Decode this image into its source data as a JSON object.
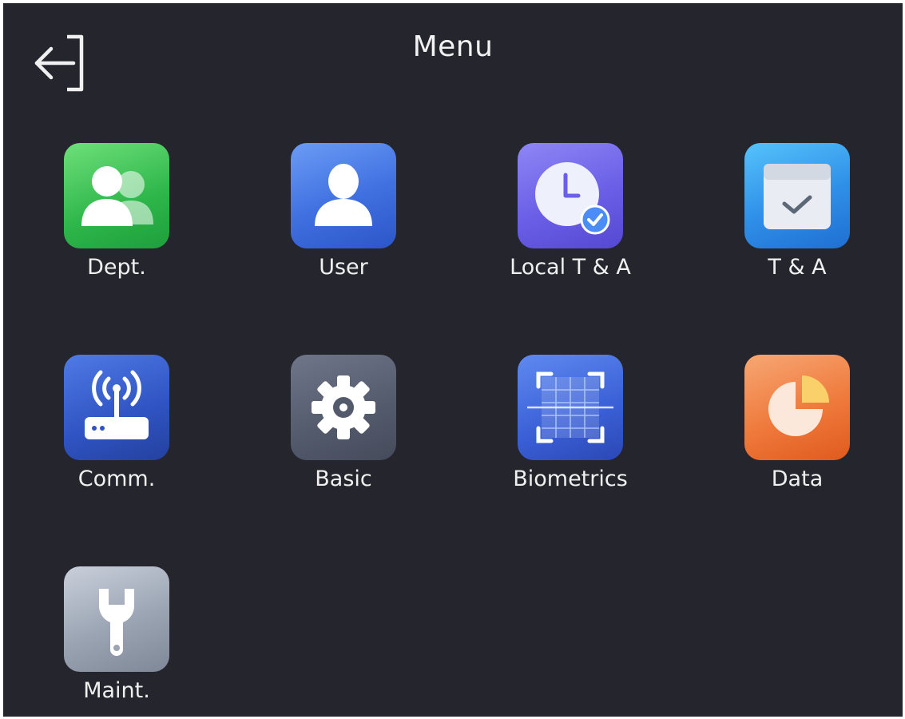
{
  "header": {
    "title": "Menu",
    "back_icon": "exit-icon"
  },
  "menu": {
    "items": [
      {
        "label": "Dept.",
        "icon": "department-icon",
        "color": "#2db64a"
      },
      {
        "label": "User",
        "icon": "user-icon",
        "color": "#3f6fe0"
      },
      {
        "label": "Local T & A",
        "icon": "clock-icon",
        "color": "#6a5fe6"
      },
      {
        "label": "T & A",
        "icon": "calendar-icon",
        "color": "#2f8fe8"
      },
      {
        "label": "Comm.",
        "icon": "router-icon",
        "color": "#2f53c2"
      },
      {
        "label": "Basic",
        "icon": "gear-icon",
        "color": "#535a6c"
      },
      {
        "label": "Biometrics",
        "icon": "biometric-scan-icon",
        "color": "#3a5fd6"
      },
      {
        "label": "Data",
        "icon": "pie-chart-icon",
        "color": "#ef7a3c"
      },
      {
        "label": "Maint.",
        "icon": "wrench-icon",
        "color": "#9ba4b3"
      }
    ]
  },
  "theme": {
    "background": "#25252d",
    "text": "#f0f0f0"
  }
}
